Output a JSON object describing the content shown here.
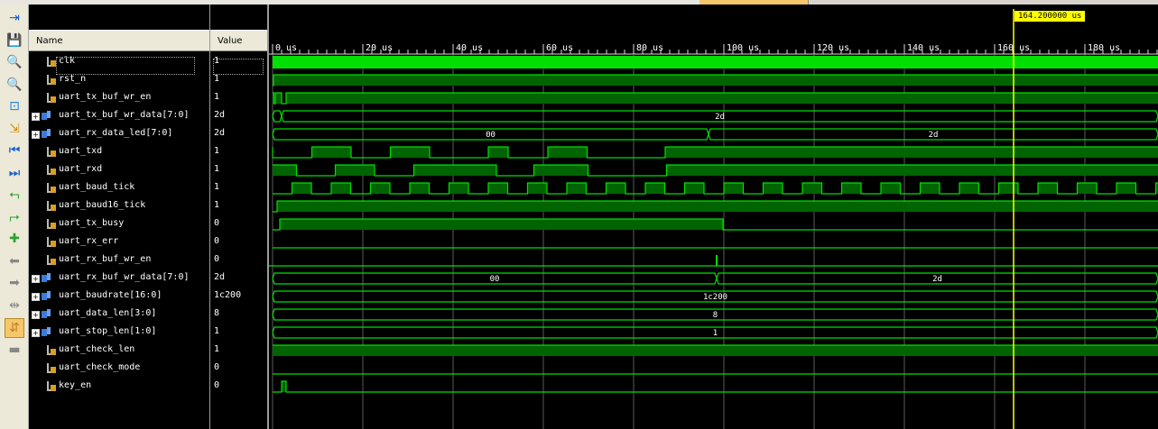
{
  "headers": {
    "name": "Name",
    "value": "Value"
  },
  "toolbar": [
    "panel-toggle-icon",
    "save-icon",
    "zoom-in-icon",
    "zoom-out-icon",
    "zoom-fit-icon",
    "go-cursor-icon",
    "go-start-icon",
    "go-end-icon",
    "prev-transition-icon",
    "next-transition-icon",
    "add-marker-icon",
    "prev-marker-icon",
    "next-marker-icon",
    "swap-cursor-icon",
    "snap-icon",
    "grid-icon"
  ],
  "timeline": {
    "ticks": [
      "0 us",
      "20 us",
      "40 us",
      "60 us",
      "80 us",
      "100 us",
      "120 us",
      "140 us",
      "160 us",
      "180 us"
    ],
    "tick_values": [
      0,
      20,
      40,
      60,
      80,
      100,
      120,
      140,
      160,
      180
    ],
    "cursor_label": "164.200000 us",
    "cursor_value": 164.2,
    "max_visible": 196.6
  },
  "colors": {
    "wave": "#00e000",
    "wave_fill": "#006400",
    "cursor": "#ffff00",
    "grid": "#5a5a5a"
  },
  "signals": [
    {
      "name": "clk",
      "value": "1",
      "kind": "bit"
    },
    {
      "name": "rst_n",
      "value": "1",
      "kind": "bit"
    },
    {
      "name": "uart_tx_buf_wr_en",
      "value": "1",
      "kind": "bit"
    },
    {
      "name": "uart_tx_buf_wr_data[7:0]",
      "value": "2d",
      "kind": "bus"
    },
    {
      "name": "uart_rx_data_led[7:0]",
      "value": "2d",
      "kind": "bus"
    },
    {
      "name": "uart_txd",
      "value": "1",
      "kind": "bit"
    },
    {
      "name": "uart_rxd",
      "value": "1",
      "kind": "bit"
    },
    {
      "name": "uart_baud_tick",
      "value": "1",
      "kind": "bit"
    },
    {
      "name": "uart_baud16_tick",
      "value": "1",
      "kind": "bit"
    },
    {
      "name": "uart_tx_busy",
      "value": "0",
      "kind": "bit"
    },
    {
      "name": "uart_rx_err",
      "value": "0",
      "kind": "bit"
    },
    {
      "name": "uart_rx_buf_wr_en",
      "value": "0",
      "kind": "bit"
    },
    {
      "name": "uart_rx_buf_wr_data[7:0]",
      "value": "2d",
      "kind": "bus"
    },
    {
      "name": "uart_baudrate[16:0]",
      "value": "1c200",
      "kind": "bus"
    },
    {
      "name": "uart_data_len[3:0]",
      "value": "8",
      "kind": "bus"
    },
    {
      "name": "uart_stop_len[1:0]",
      "value": "1",
      "kind": "bus"
    },
    {
      "name": "uart_check_len",
      "value": "1",
      "kind": "bit"
    },
    {
      "name": "uart_check_mode",
      "value": "0",
      "kind": "bit"
    },
    {
      "name": "key_en",
      "value": "0",
      "kind": "bit"
    }
  ],
  "bus_labels": {
    "uart_tx_buf_wr_data": {
      "segments": [
        {
          "from": 0,
          "to": 2,
          "text": ""
        },
        {
          "from": 2,
          "to": 197,
          "text": "2d"
        }
      ]
    },
    "uart_rx_data_led": {
      "segments": [
        {
          "from": 0,
          "to": 96.6,
          "text": "00"
        },
        {
          "from": 96.6,
          "to": 197,
          "text": "2d"
        }
      ]
    },
    "uart_rx_buf_wr_data": {
      "segments": [
        {
          "from": 0,
          "to": 98.4,
          "text": "00"
        },
        {
          "from": 98.4,
          "to": 197,
          "text": "2d"
        }
      ]
    },
    "uart_baudrate": {
      "segments": [
        {
          "from": 0,
          "to": 197,
          "text": "1c200"
        }
      ]
    },
    "uart_data_len": {
      "segments": [
        {
          "from": 0,
          "to": 197,
          "text": "8"
        }
      ]
    },
    "uart_stop_len": {
      "segments": [
        {
          "from": 0,
          "to": 197,
          "text": "1"
        }
      ]
    }
  }
}
